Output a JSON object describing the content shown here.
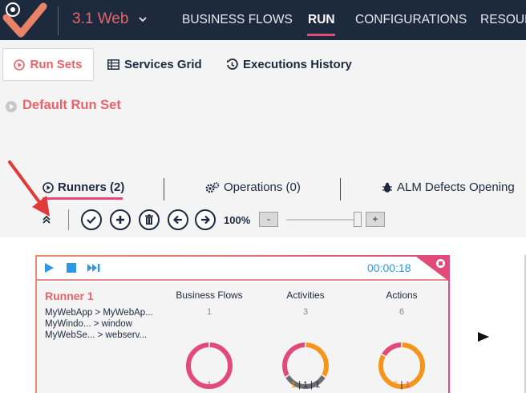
{
  "topbar": {
    "solution_name": "3.1 Web",
    "nav": [
      "BUSINESS FLOWS",
      "RUN",
      "CONFIGURATIONS",
      "RESOUR"
    ],
    "active_nav": "RUN"
  },
  "subtabs": {
    "run_sets": "Run Sets",
    "services_grid": "Services Grid",
    "executions_history": "Executions History"
  },
  "runset": {
    "title": "Default Run Set",
    "tabs": {
      "runners": "Runners (2)",
      "operations": "Operations (0)",
      "alm": "ALM Defects Opening"
    },
    "zoom": {
      "label": "100%",
      "minus": "-",
      "plus": "+",
      "level": 1.0
    }
  },
  "runner": {
    "timer": "00:00:18",
    "name": "Runner 1",
    "lines": [
      "MyWebApp > MyWebAp...",
      "MyWindo... > window",
      "MyWebSe... > webserv..."
    ],
    "stats": [
      {
        "title": "Business Flows",
        "count": "1",
        "breakdown": [
          {
            "text": "1",
            "color": "#e24a7a"
          }
        ]
      },
      {
        "title": "Activities",
        "count": "3",
        "breakdown": [
          {
            "text": "1",
            "color": "#f7941d"
          },
          {
            "text": " | ",
            "color": "#1d2a3e"
          },
          {
            "text": "1",
            "color": "#1d2a3e"
          },
          {
            "text": " | ",
            "color": "#1d2a3e"
          },
          {
            "text": "1",
            "color": "#1d2a3e"
          }
        ]
      },
      {
        "title": "Actions",
        "count": "6",
        "breakdown": [
          {
            "text": "5",
            "color": "#f7941d"
          },
          {
            "text": " | ",
            "color": "#1d2a3e"
          },
          {
            "text": "1",
            "color": "#e24a7a"
          }
        ]
      }
    ]
  },
  "colors": {
    "nav_bg": "#1d2a3e",
    "accent": "#e8636a",
    "pink": "#e24a7a",
    "orange": "#f7941d",
    "gray": "#6d6d6d",
    "timer_blue": "#2f97e6"
  }
}
